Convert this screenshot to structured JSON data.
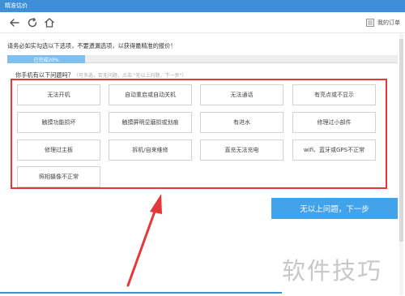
{
  "window": {
    "title": "精准估价"
  },
  "toolbar": {
    "orders_label": "我的订单"
  },
  "instruction": "请务必如实勾选以下选项，不要遗漏选项，以获得最精准的报价！",
  "progress": {
    "label": "已完成20%",
    "fraction": 0.2
  },
  "question": {
    "text": "你手机有以下问题吗？",
    "hint": "（可多选，若无问题，点击 \"无以上问题，下一步\"）"
  },
  "options": [
    "无法开机",
    "自动重启或自动关机",
    "无法通话",
    "有亮点或不显示",
    "触摸功能损坏",
    "触摸屏明显磨损或划痕",
    "有进水",
    "修理过小部件",
    "修理过主板",
    "拆机/自来维修",
    "直充无法充电",
    "wifi、蓝牙或GPS不正常",
    "照相摄像不正常"
  ],
  "next_button": "无以上问题，下一步",
  "watermark": "软件技巧",
  "colors": {
    "titlebar": "#3f8fd8",
    "accent": "#42a3ea",
    "highlight": "#e53939",
    "progress": "#7fbff0"
  },
  "icons": {
    "back": "arrow-left-icon",
    "refresh": "refresh-icon",
    "home": "home-icon",
    "orders": "list-icon"
  }
}
